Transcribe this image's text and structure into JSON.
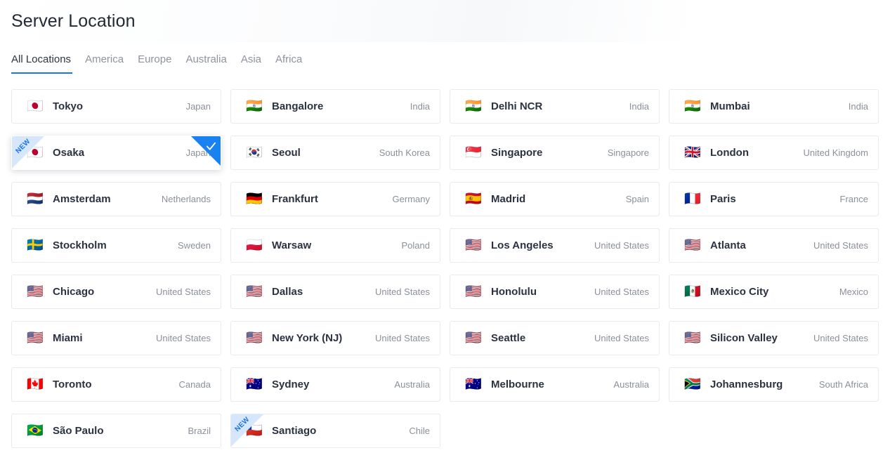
{
  "header": {
    "title": "Server Location"
  },
  "tabs": [
    {
      "label": "All Locations",
      "active": true
    },
    {
      "label": "America",
      "active": false
    },
    {
      "label": "Europe",
      "active": false
    },
    {
      "label": "Australia",
      "active": false
    },
    {
      "label": "Asia",
      "active": false
    },
    {
      "label": "Africa",
      "active": false
    }
  ],
  "badges": {
    "new_label": "NEW",
    "selected_icon": "check-icon"
  },
  "colors": {
    "accent": "#1a73e8",
    "selected_ribbon": "#1a81f0",
    "new_ribbon_bg": "#d7e7fb",
    "city_text": "#2b3240",
    "country_text": "#8b9099",
    "card_border": "#e8eaee"
  },
  "locations": [
    {
      "city": "Tokyo",
      "country": "Japan",
      "flag": "🇯🇵",
      "flag_name": "flag-japan",
      "is_new": false,
      "selected": false
    },
    {
      "city": "Bangalore",
      "country": "India",
      "flag": "🇮🇳",
      "flag_name": "flag-india",
      "is_new": false,
      "selected": false
    },
    {
      "city": "Delhi NCR",
      "country": "India",
      "flag": "🇮🇳",
      "flag_name": "flag-india",
      "is_new": false,
      "selected": false
    },
    {
      "city": "Mumbai",
      "country": "India",
      "flag": "🇮🇳",
      "flag_name": "flag-india",
      "is_new": false,
      "selected": false
    },
    {
      "city": "Osaka",
      "country": "Japan",
      "flag": "🇯🇵",
      "flag_name": "flag-japan",
      "is_new": true,
      "selected": true
    },
    {
      "city": "Seoul",
      "country": "South Korea",
      "flag": "🇰🇷",
      "flag_name": "flag-south-korea",
      "is_new": false,
      "selected": false
    },
    {
      "city": "Singapore",
      "country": "Singapore",
      "flag": "🇸🇬",
      "flag_name": "flag-singapore",
      "is_new": false,
      "selected": false
    },
    {
      "city": "London",
      "country": "United Kingdom",
      "flag": "🇬🇧",
      "flag_name": "flag-united-kingdom",
      "is_new": false,
      "selected": false
    },
    {
      "city": "Amsterdam",
      "country": "Netherlands",
      "flag": "🇳🇱",
      "flag_name": "flag-netherlands",
      "is_new": false,
      "selected": false
    },
    {
      "city": "Frankfurt",
      "country": "Germany",
      "flag": "🇩🇪",
      "flag_name": "flag-germany",
      "is_new": false,
      "selected": false
    },
    {
      "city": "Madrid",
      "country": "Spain",
      "flag": "🇪🇸",
      "flag_name": "flag-spain",
      "is_new": false,
      "selected": false
    },
    {
      "city": "Paris",
      "country": "France",
      "flag": "🇫🇷",
      "flag_name": "flag-france",
      "is_new": false,
      "selected": false
    },
    {
      "city": "Stockholm",
      "country": "Sweden",
      "flag": "🇸🇪",
      "flag_name": "flag-sweden",
      "is_new": false,
      "selected": false
    },
    {
      "city": "Warsaw",
      "country": "Poland",
      "flag": "🇵🇱",
      "flag_name": "flag-poland",
      "is_new": false,
      "selected": false
    },
    {
      "city": "Los Angeles",
      "country": "United States",
      "flag": "🇺🇸",
      "flag_name": "flag-united-states",
      "is_new": false,
      "selected": false
    },
    {
      "city": "Atlanta",
      "country": "United States",
      "flag": "🇺🇸",
      "flag_name": "flag-united-states",
      "is_new": false,
      "selected": false
    },
    {
      "city": "Chicago",
      "country": "United States",
      "flag": "🇺🇸",
      "flag_name": "flag-united-states",
      "is_new": false,
      "selected": false
    },
    {
      "city": "Dallas",
      "country": "United States",
      "flag": "🇺🇸",
      "flag_name": "flag-united-states",
      "is_new": false,
      "selected": false
    },
    {
      "city": "Honolulu",
      "country": "United States",
      "flag": "🇺🇸",
      "flag_name": "flag-united-states",
      "is_new": false,
      "selected": false
    },
    {
      "city": "Mexico City",
      "country": "Mexico",
      "flag": "🇲🇽",
      "flag_name": "flag-mexico",
      "is_new": false,
      "selected": false
    },
    {
      "city": "Miami",
      "country": "United States",
      "flag": "🇺🇸",
      "flag_name": "flag-united-states",
      "is_new": false,
      "selected": false
    },
    {
      "city": "New York (NJ)",
      "country": "United States",
      "flag": "🇺🇸",
      "flag_name": "flag-united-states",
      "is_new": false,
      "selected": false
    },
    {
      "city": "Seattle",
      "country": "United States",
      "flag": "🇺🇸",
      "flag_name": "flag-united-states",
      "is_new": false,
      "selected": false
    },
    {
      "city": "Silicon Valley",
      "country": "United States",
      "flag": "🇺🇸",
      "flag_name": "flag-united-states",
      "is_new": false,
      "selected": false
    },
    {
      "city": "Toronto",
      "country": "Canada",
      "flag": "🇨🇦",
      "flag_name": "flag-canada",
      "is_new": false,
      "selected": false
    },
    {
      "city": "Sydney",
      "country": "Australia",
      "flag": "🇦🇺",
      "flag_name": "flag-australia",
      "is_new": false,
      "selected": false
    },
    {
      "city": "Melbourne",
      "country": "Australia",
      "flag": "🇦🇺",
      "flag_name": "flag-australia",
      "is_new": false,
      "selected": false
    },
    {
      "city": "Johannesburg",
      "country": "South Africa",
      "flag": "🇿🇦",
      "flag_name": "flag-south-africa",
      "is_new": false,
      "selected": false
    },
    {
      "city": "São Paulo",
      "country": "Brazil",
      "flag": "🇧🇷",
      "flag_name": "flag-brazil",
      "is_new": false,
      "selected": false
    },
    {
      "city": "Santiago",
      "country": "Chile",
      "flag": "🇨🇱",
      "flag_name": "flag-chile",
      "is_new": true,
      "selected": false
    }
  ]
}
